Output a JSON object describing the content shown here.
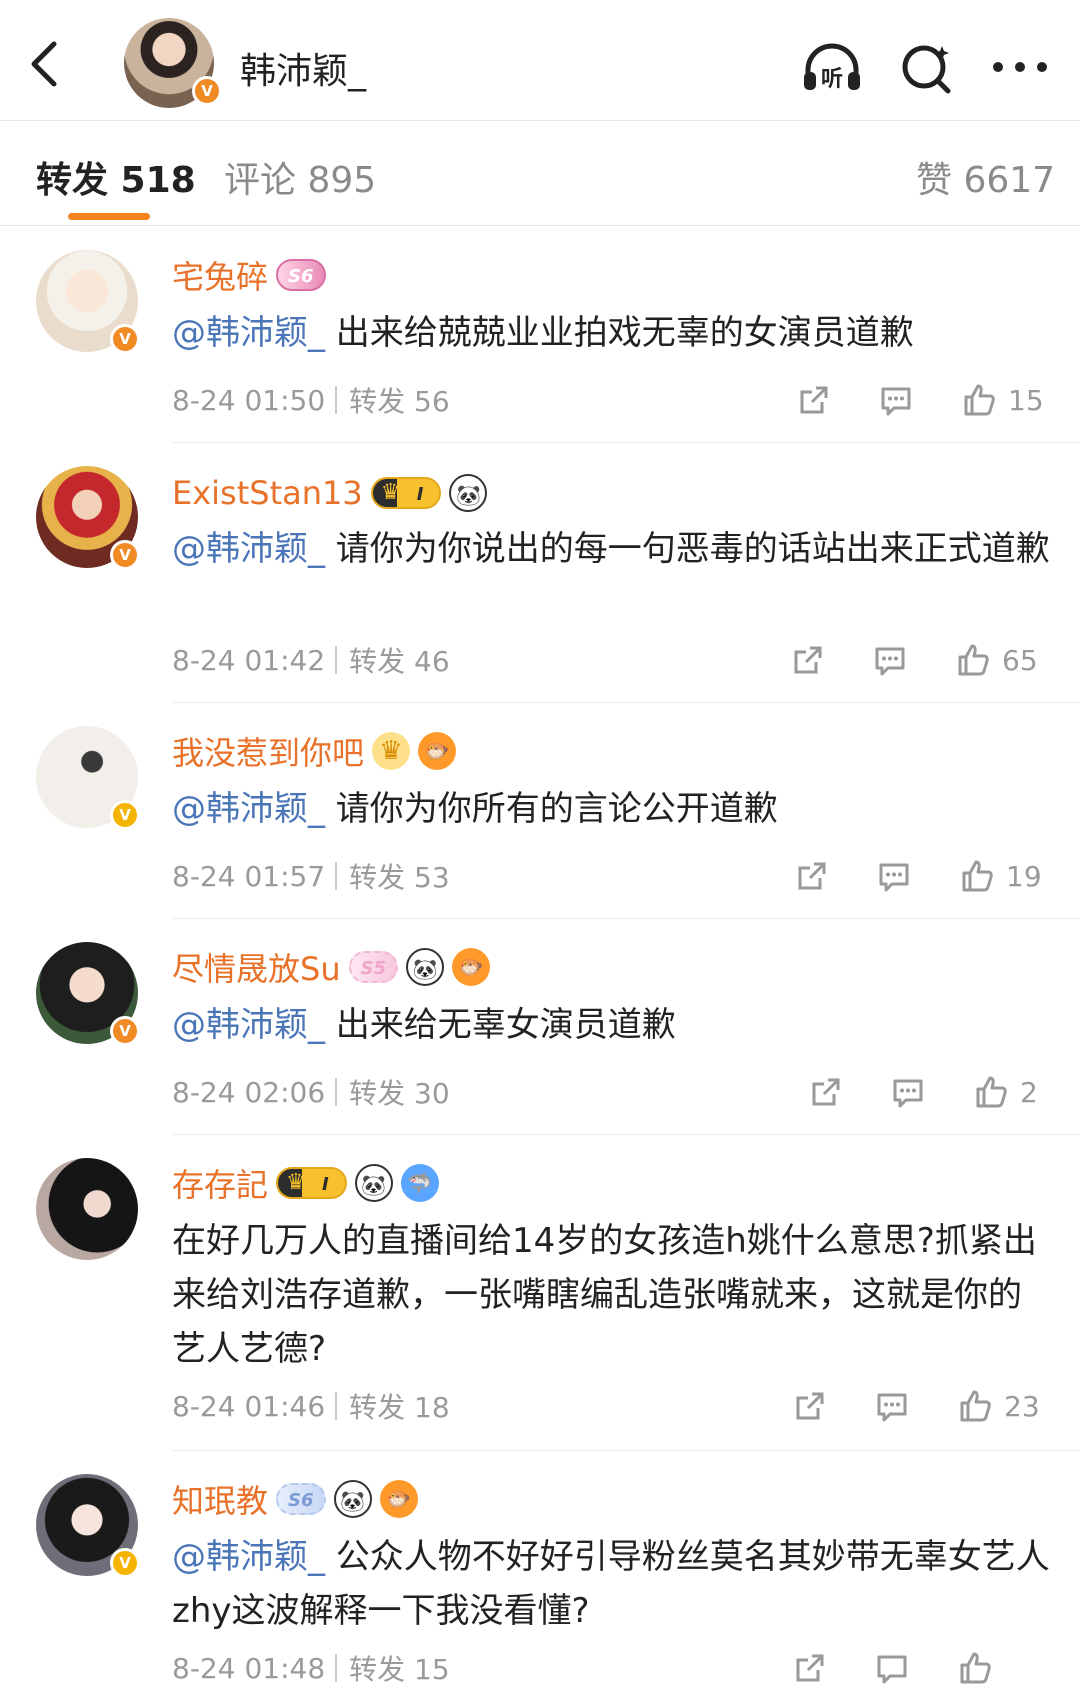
{
  "header": {
    "account_name": "韩沛颖_",
    "listen_icon_label": "听",
    "colors": {
      "accent": "#f7831f",
      "name": "#e8722a",
      "mention": "#4a76b8",
      "verified": "#f08a24"
    }
  },
  "tabs": [
    {
      "label": "转发 518",
      "active": true
    },
    {
      "label": "评论 895",
      "active": false
    },
    {
      "label": "赞 6617",
      "active": false
    }
  ],
  "comments": [
    {
      "user": "宅兔碎",
      "badges": [
        "S6"
      ],
      "mention": "@韩沛颖_",
      "text": " 出来给兢兢业业拍戏无辜的女演员道歉",
      "time": "8-24 01:50",
      "repost": "转发 56",
      "likes": "15"
    },
    {
      "user": "ExistStan13",
      "badges": [
        "I"
      ],
      "mention": "@韩沛颖_",
      "text": " 请你为你说出的每一句恶毒的话站出来正式道歉",
      "time": "8-24 01:42",
      "repost": "转发 46",
      "likes": "65"
    },
    {
      "user": "我没惹到你吧",
      "badges": [],
      "mention": "@韩沛颖_",
      "text": " 请你为你所有的言论公开道歉",
      "time": "8-24 01:57",
      "repost": "转发 53",
      "likes": "19"
    },
    {
      "user": "尽情晟放Su",
      "badges": [
        "S5"
      ],
      "mention": "@韩沛颖_",
      "text": " 出来给无辜女演员道歉",
      "time": "8-24 02:06",
      "repost": "转发 30",
      "likes": "2"
    },
    {
      "user": "存存記",
      "badges": [
        "I"
      ],
      "mention": "",
      "text": "在好几万人的直播间给14岁的女孩造h姚什么意思?抓紧出来给刘浩存道歉，一张嘴瞎编乱造张嘴就来，这就是你的艺人艺德?",
      "time": "8-24 01:46",
      "repost": "转发 18",
      "likes": "23"
    },
    {
      "user": "知珉教",
      "badges": [
        "S6"
      ],
      "mention": "@韩沛颖_",
      "text": " 公众人物不好好引导粉丝莫名其妙带无辜女艺人 zhy这波解释一下我没看懂?",
      "time": "8-24 01:48",
      "repost": "转发 15",
      "likes": ""
    }
  ]
}
